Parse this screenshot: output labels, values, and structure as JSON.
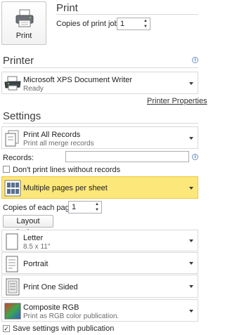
{
  "print": {
    "heading": "Print",
    "button_label": "Print",
    "copies_label": "Copies of print job:",
    "copies_value": "1"
  },
  "printer": {
    "heading": "Printer",
    "name": "Microsoft XPS Document Writer",
    "status": "Ready",
    "properties_link": "Printer Properties"
  },
  "settings": {
    "heading": "Settings",
    "records_dropdown": {
      "title": "Print All Records",
      "subtitle": "Print all merge records"
    },
    "records_label": "Records:",
    "records_value": "",
    "dont_print_blank_label": "Don't print lines without records",
    "dont_print_blank_checked": false,
    "layout_dropdown": {
      "title": "Multiple pages per sheet"
    },
    "copies_each_label": "Copies of each page:",
    "copies_each_value": "1",
    "layout_options_button": "Layout Options",
    "paper_dropdown": {
      "title": "Letter",
      "subtitle": "8.5 x 11\""
    },
    "orientation_dropdown": {
      "title": "Portrait"
    },
    "sides_dropdown": {
      "title": "Print One Sided"
    },
    "color_dropdown": {
      "title": "Composite RGB",
      "subtitle": "Print as RGB color publication."
    },
    "save_settings_label": "Save settings with publication",
    "save_settings_checked": true
  },
  "colors": {
    "highlight": "#fce77a",
    "highlight_border": "#f0c842",
    "info_blue": "#3b6fb6"
  },
  "icons": {
    "print_button": "printer-icon",
    "printer": "printer-icon",
    "records": "pages-icon",
    "layout": "multiple-pages-icon",
    "paper": "page-icon",
    "orientation": "portrait-page-icon",
    "sides": "one-sided-icon",
    "color": "rgb-color-icon",
    "info": "info-icon"
  }
}
